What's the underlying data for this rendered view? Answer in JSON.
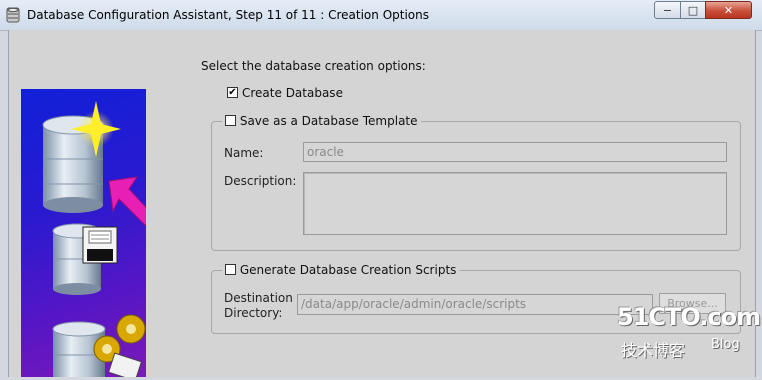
{
  "window": {
    "title": "Database Configuration Assistant, Step 11 of 11 : Creation Options",
    "controls": {
      "minimize": "−",
      "maximize": "□",
      "close": "✕"
    }
  },
  "main": {
    "intro": "Select the database creation options:",
    "create_database": {
      "label": "Create Database",
      "checked": true,
      "mark": "✔"
    },
    "template_group": {
      "label": "Save as a Database Template",
      "checked": false,
      "name_label": "Name:",
      "name_value": "oracle",
      "description_label": "Description:",
      "description_value": ""
    },
    "scripts_group": {
      "label": "Generate Database Creation Scripts",
      "checked": false,
      "destination_label_line1": "Destination",
      "destination_label_line2": "Directory:",
      "destination_value": "/data/app/oracle/admin/oracle/scripts",
      "browse_label": "Browse..."
    }
  },
  "watermark": {
    "site": "51CTO.com",
    "tagline": "技术博客",
    "blog": "Blog"
  },
  "colors": {
    "accent_arrow": "#e81fb5",
    "side_bg": "#2a1ad0"
  }
}
